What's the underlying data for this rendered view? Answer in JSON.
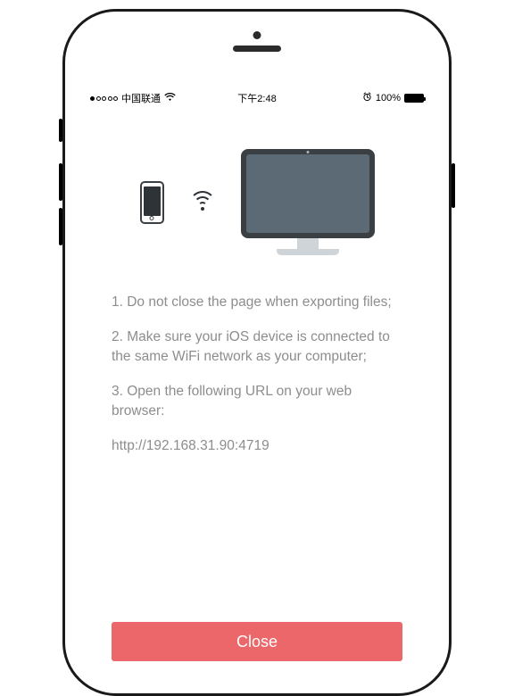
{
  "status_bar": {
    "carrier": "中国联通",
    "time": "下午2:48",
    "battery_pct": "100%"
  },
  "illustration": {
    "phone_icon": "phone-icon",
    "wifi_icon": "wifi-icon",
    "monitor_icon": "monitor-icon"
  },
  "instructions": {
    "step1": "1. Do not close the page when exporting files;",
    "step2": "2. Make sure your iOS device is connected to the same WiFi network as your computer;",
    "step3": "3. Open the following URL on your web browser:",
    "url": "http://192.168.31.90:4719"
  },
  "buttons": {
    "close": "Close"
  },
  "colors": {
    "accent": "#eb6769",
    "text_muted": "#8d8d8d",
    "monitor_body": "#3a3f44",
    "monitor_screen": "#5b6a74"
  }
}
